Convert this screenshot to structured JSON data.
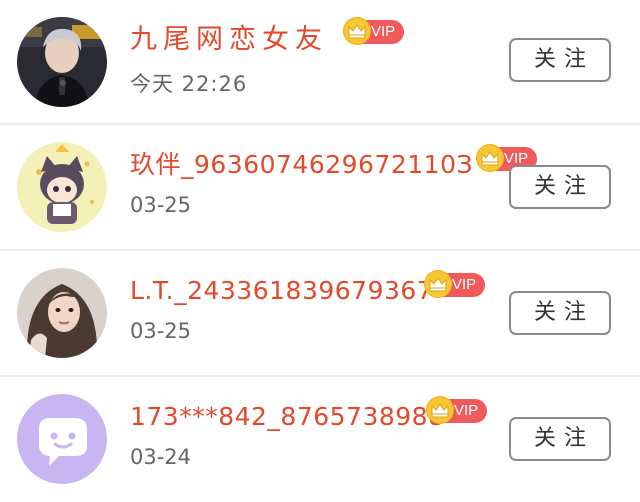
{
  "users": [
    {
      "name": "九尾网恋女友",
      "badge": "VIP",
      "time": "今天 22:26",
      "follow_label": "关注",
      "avatar": "photo-young-man-icon"
    },
    {
      "name": "玖伴_9636074629672110З",
      "badge": "VIP",
      "time": "03-25",
      "follow_label": "关注",
      "avatar": "anime-cat-character-icon"
    },
    {
      "name": "L.T._243361839679367",
      "badge": "VIP",
      "time": "03-25",
      "follow_label": "关注",
      "avatar": "photo-young-woman-icon"
    },
    {
      "name": "173***842_8765738988",
      "badge": "VIP",
      "time": "03-24",
      "follow_label": "关注",
      "avatar": "chat-bubble-face-icon"
    }
  ],
  "colors": {
    "name": "#e24a2b",
    "vip_badge": "#f05a5a",
    "crown": "#f7c734",
    "divider": "#ececec",
    "button_border": "#8a8a8a",
    "placeholder_avatar": "#c8b6f2"
  }
}
